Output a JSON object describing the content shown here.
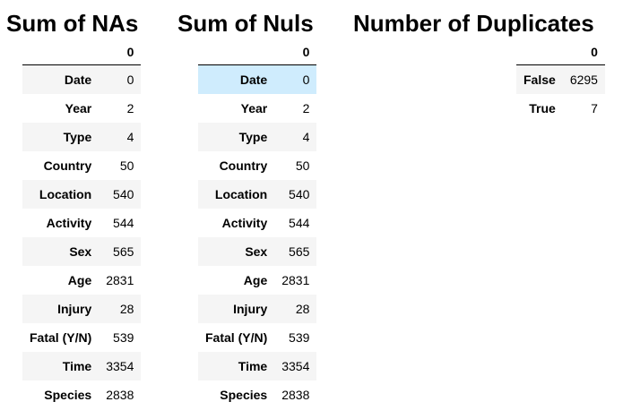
{
  "panels": [
    {
      "title": "Sum of NAs",
      "column": "0",
      "rows": [
        {
          "label": "Date",
          "value": "0"
        },
        {
          "label": "Year",
          "value": "2"
        },
        {
          "label": "Type",
          "value": "4"
        },
        {
          "label": "Country",
          "value": "50"
        },
        {
          "label": "Location",
          "value": "540"
        },
        {
          "label": "Activity",
          "value": "544"
        },
        {
          "label": "Sex",
          "value": "565"
        },
        {
          "label": "Age",
          "value": "2831"
        },
        {
          "label": "Injury",
          "value": "28"
        },
        {
          "label": "Fatal (Y/N)",
          "value": "539"
        },
        {
          "label": "Time",
          "value": "3354"
        },
        {
          "label": "Species",
          "value": "2838"
        }
      ]
    },
    {
      "title": "Sum of Nuls",
      "column": "0",
      "rows": [
        {
          "label": "Date",
          "value": "0"
        },
        {
          "label": "Year",
          "value": "2"
        },
        {
          "label": "Type",
          "value": "4"
        },
        {
          "label": "Country",
          "value": "50"
        },
        {
          "label": "Location",
          "value": "540"
        },
        {
          "label": "Activity",
          "value": "544"
        },
        {
          "label": "Sex",
          "value": "565"
        },
        {
          "label": "Age",
          "value": "2831"
        },
        {
          "label": "Injury",
          "value": "28"
        },
        {
          "label": "Fatal (Y/N)",
          "value": "539"
        },
        {
          "label": "Time",
          "value": "3354"
        },
        {
          "label": "Species",
          "value": "2838"
        }
      ]
    },
    {
      "title": "Number of Duplicates",
      "column": "0",
      "rows": [
        {
          "label": "False",
          "value": "6295"
        },
        {
          "label": "True",
          "value": "7"
        }
      ]
    }
  ],
  "hovered_row": {
    "panel": "Sum of Nuls",
    "label": "Date"
  },
  "colors": {
    "stripe": "#f5f5f5",
    "hover_highlight": "#cfecfd",
    "header_rule": "#000000"
  }
}
